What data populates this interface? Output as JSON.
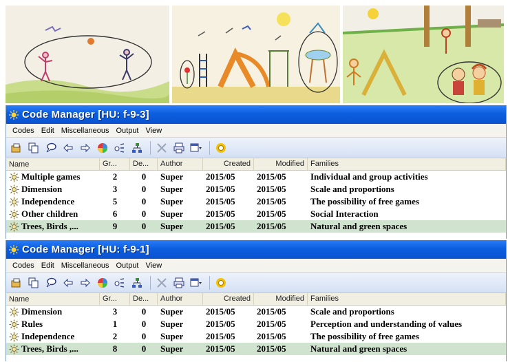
{
  "windows": [
    {
      "title": "Code Manager [HU: f-9-3]",
      "menu": [
        "Codes",
        "Edit",
        "Miscellaneous",
        "Output",
        "View"
      ],
      "columns": [
        "Name",
        "Gr...",
        "De...",
        "Author",
        "Created",
        "Modified",
        "Families"
      ],
      "rows": [
        {
          "name": "Multiple games",
          "gr": "2",
          "de": "0",
          "author": "Super",
          "created": "2015/05",
          "modified": "2015/05",
          "families": "Individual and group activities",
          "selected": false
        },
        {
          "name": "Dimension",
          "gr": "3",
          "de": "0",
          "author": "Super",
          "created": "2015/05",
          "modified": "2015/05",
          "families": "Scale and proportions",
          "selected": false
        },
        {
          "name": "Independence",
          "gr": "5",
          "de": "0",
          "author": "Super",
          "created": "2015/05",
          "modified": "2015/05",
          "families": "The possibility of free games",
          "selected": false
        },
        {
          "name": "Other children",
          "gr": "6",
          "de": "0",
          "author": "Super",
          "created": "2015/05",
          "modified": "2015/05",
          "families": "Social Interaction",
          "selected": false
        },
        {
          "name": "Trees, Birds ,...",
          "gr": "9",
          "de": "0",
          "author": "Super",
          "created": "2015/05",
          "modified": "2015/05",
          "families": "Natural and green spaces",
          "selected": true
        }
      ]
    },
    {
      "title": "Code Manager [HU: f-9-1]",
      "menu": [
        "Codes",
        "Edit",
        "Miscellaneous",
        "Output",
        "View"
      ],
      "columns": [
        "Name",
        "Gr...",
        "De...",
        "Author",
        "Created",
        "Modified",
        "Families"
      ],
      "rows": [
        {
          "name": "Dimension",
          "gr": "3",
          "de": "0",
          "author": "Super",
          "created": "2015/05",
          "modified": "2015/05",
          "families": "Scale and proportions",
          "selected": false
        },
        {
          "name": "Rules",
          "gr": "1",
          "de": "0",
          "author": "Super",
          "created": "2015/05",
          "modified": "2015/05",
          "families": "Perception and understanding of values",
          "selected": false
        },
        {
          "name": "Independence",
          "gr": "2",
          "de": "0",
          "author": "Super",
          "created": "2015/05",
          "modified": "2015/05",
          "families": "The possibility of free games",
          "selected": false
        },
        {
          "name": "Trees, Birds ,...",
          "gr": "8",
          "de": "0",
          "author": "Super",
          "created": "2015/05",
          "modified": "2015/05",
          "families": "Natural and green spaces",
          "selected": true
        }
      ]
    }
  ],
  "toolbar_icons": [
    "new-code-icon",
    "copy-icon",
    "comment-icon",
    "arrow-left-icon",
    "arrow-right-icon",
    "color-wheel-icon",
    "link-icon",
    "network-icon",
    "delete-icon",
    "print-icon",
    "view-dropdown-icon",
    "settings-icon"
  ],
  "drawings": [
    "drawing-children-playing-ball",
    "drawing-playground",
    "drawing-park-children"
  ],
  "colors": {
    "titlebar": "#0c5ee0",
    "selected_row": "#cfe3cf",
    "toolbar": "#d4e0f4"
  }
}
